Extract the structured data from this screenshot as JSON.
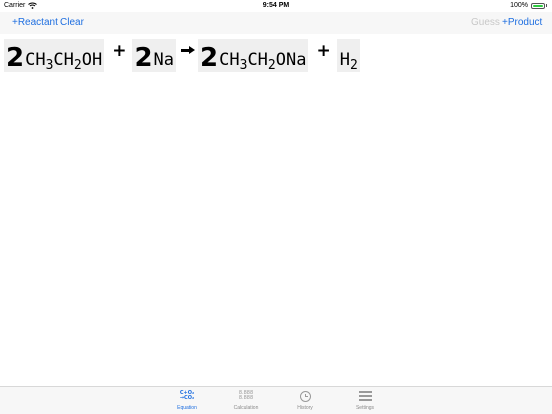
{
  "status": {
    "carrier": "Carrier",
    "time": "9:54 PM",
    "battery": "100%"
  },
  "toolbar": {
    "add_reactant": "+Reactant",
    "clear": "Clear",
    "guess": "Guess",
    "add_product": "+Product"
  },
  "equation": {
    "reactants": [
      {
        "coef": "2",
        "parts": [
          "CH",
          "3",
          "CH",
          "2",
          "OH"
        ]
      },
      {
        "coef": "2",
        "parts": [
          "Na"
        ]
      }
    ],
    "products": [
      {
        "coef": "2",
        "parts": [
          "CH",
          "3",
          "CH",
          "2",
          "ONa"
        ]
      },
      {
        "coef": "",
        "parts": [
          "H",
          "2"
        ]
      }
    ],
    "plus": "+"
  },
  "tabs": [
    {
      "label": "Equation",
      "icon": "equation-icon",
      "active": true,
      "icon_text": [
        "C+O₂",
        "→CO₂"
      ]
    },
    {
      "label": "Calculation",
      "icon": "calculation-icon",
      "active": false,
      "icon_text": [
        "8.888",
        "8.888"
      ]
    },
    {
      "label": "History",
      "icon": "clock-icon",
      "active": false
    },
    {
      "label": "Settings",
      "icon": "menu-icon",
      "active": false
    }
  ],
  "colors": {
    "accent": "#1f6fe0",
    "inactive": "#8a8a8a",
    "term_bg": "#efefef",
    "battery": "#2ecc40"
  }
}
